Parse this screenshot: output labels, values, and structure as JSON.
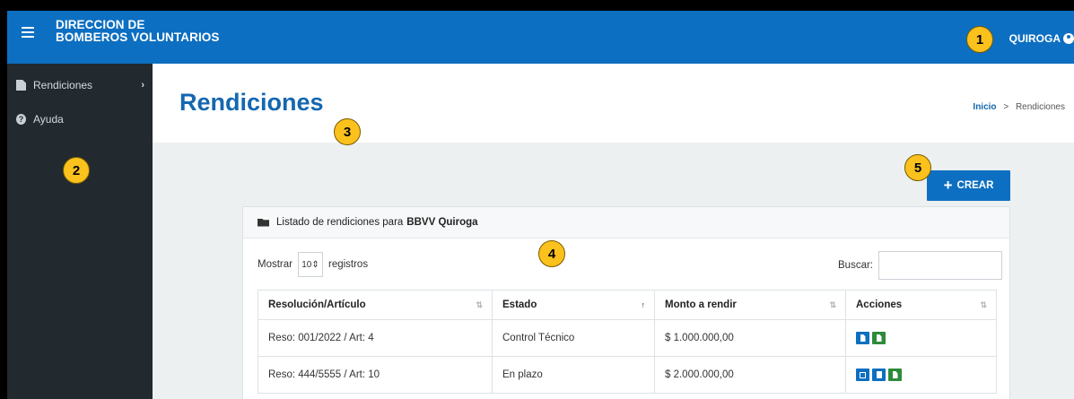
{
  "header": {
    "brand_line1": "DIRECCION DE",
    "brand_line2": "BOMBEROS VOLUNTARIOS",
    "user": "QUIROGA"
  },
  "sidebar": {
    "items": [
      {
        "label": "Rendiciones",
        "icon": "document-icon"
      },
      {
        "label": "Ayuda",
        "icon": "help-icon"
      }
    ]
  },
  "page": {
    "title": "Rendiciones",
    "breadcrumb_home": "Inicio",
    "breadcrumb_sep": ">",
    "breadcrumb_current": "Rendiciones"
  },
  "create_button": {
    "label": "CREAR"
  },
  "panel": {
    "title_prefix": "Listado de rendiciones para",
    "title_entity": "BBVV Quiroga",
    "show_label": "Mostrar",
    "show_value": "10",
    "records_label": "registros",
    "search_label": "Buscar:",
    "search_value": "",
    "columns": [
      "Resolución/Artículo",
      "Estado",
      "Monto a rendir",
      "Acciones"
    ],
    "rows": [
      {
        "resolution": "Reso: 001/2022 / Art: 4",
        "status": "Control Técnico",
        "amount": "$ 1.000.000,00"
      },
      {
        "resolution": "Reso: 444/5555 / Art: 10",
        "status": "En plazo",
        "amount": "$ 2.000.000,00"
      }
    ]
  },
  "annotations": [
    "1",
    "2",
    "3",
    "4",
    "5"
  ],
  "colors": {
    "primary": "#0d6fc1",
    "sidebar": "#222a30",
    "badge": "#fbc11c",
    "success": "#2e8b3a"
  }
}
